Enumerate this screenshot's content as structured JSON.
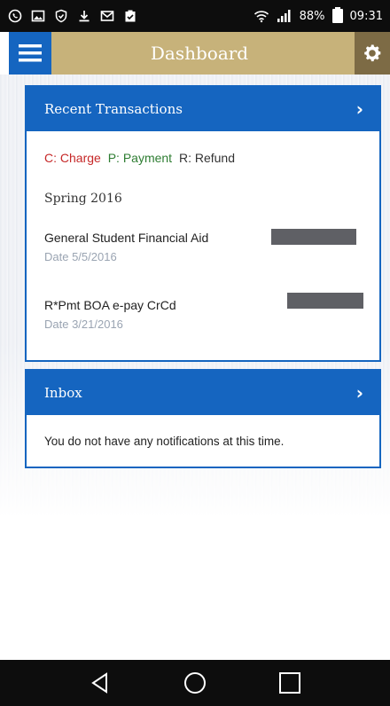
{
  "status_bar": {
    "battery_percent": "88%",
    "time": "09:31",
    "icons_left": [
      "whatsapp-icon",
      "image-icon",
      "shield-check-icon",
      "download-icon",
      "gmail-icon",
      "clipboard-check-icon"
    ],
    "icons_right": [
      "wifi-icon",
      "signal-icon",
      "battery-icon"
    ]
  },
  "header": {
    "title": "Dashboard",
    "menu_icon": "hamburger-menu-icon",
    "settings_icon": "gear-icon",
    "colors": {
      "bar": "#c7b27a",
      "menu": "#1565c0",
      "settings": "#7d6b45"
    }
  },
  "transactions_card": {
    "title": "Recent Transactions",
    "legend": {
      "charge": "C: Charge",
      "payment": "P: Payment",
      "refund": "R: Refund"
    },
    "term": "Spring 2016",
    "items": [
      {
        "description": "General Student Financial Aid",
        "date": "Date 5/5/2016"
      },
      {
        "description": "R*Pmt BOA e-pay CrCd",
        "date": "Date 3/21/2016"
      }
    ]
  },
  "inbox_card": {
    "title": "Inbox",
    "message": "You do not have any notifications at this time."
  },
  "nav_bar": {
    "buttons": [
      "back-icon",
      "home-icon",
      "recents-icon"
    ]
  },
  "colors": {
    "accent": "#1565c0",
    "charge": "#c62828",
    "payment": "#2e7d32"
  }
}
